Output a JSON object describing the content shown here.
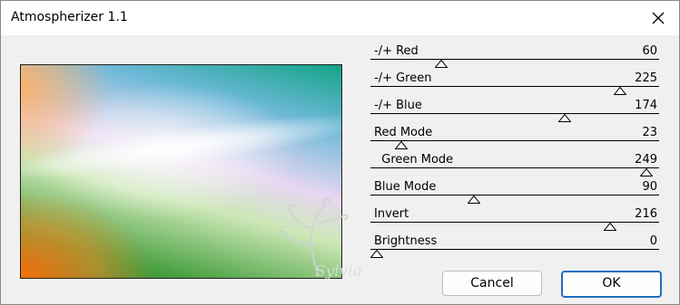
{
  "window": {
    "title": "Atmospherizer 1.1"
  },
  "sliders": [
    {
      "label": "-/+ Red",
      "value": "60",
      "level": 0.235
    },
    {
      "label": "-/+ Green",
      "value": "225",
      "level": 0.882
    },
    {
      "label": "-/+ Blue",
      "value": "174",
      "level": 0.682
    },
    {
      "label": "Red Mode",
      "value": "23",
      "level": 0.09
    },
    {
      "label": "  Green Mode",
      "value": "249",
      "level": 0.976
    },
    {
      "label": "Blue Mode",
      "value": "90",
      "level": 0.353
    },
    {
      "label": "Invert",
      "value": "216",
      "level": 0.847
    },
    {
      "label": "Brightness",
      "value": "0",
      "level": 0.0
    }
  ],
  "buttons": {
    "cancel": "Cancel",
    "ok": "OK"
  },
  "watermark": {
    "text": "Sylviane"
  },
  "colors": {
    "accent": "#1f6fbf",
    "background": "#f0f0f0"
  }
}
